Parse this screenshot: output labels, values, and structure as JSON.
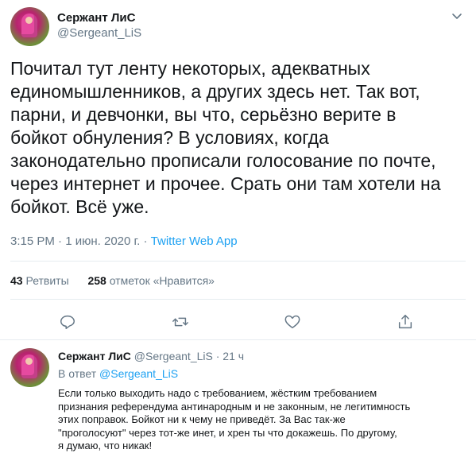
{
  "colors": {
    "accent": "#1da1f2",
    "secondary_text": "#657786",
    "primary_text": "#14171a",
    "divider": "#e6ecf0"
  },
  "tweet": {
    "author_name": "Сержант ЛиС",
    "author_handle": "@Sergeant_LiS",
    "text_lines": [
      "Почитал тут ленту некоторых, адекватных",
      "единомышленников, а других здесь нет. Так вот,",
      "парни, и девчонки, вы что, серьёзно верите в",
      "бойкот обнуления? В условиях, когда",
      "законодательно прописали голосование по почте,",
      "через интернет и прочее. Срать они там хотели на",
      "бойкот. Всё уже."
    ],
    "time": "3:15 PM",
    "sep": "·",
    "date": "1 июн. 2020 г.",
    "sep2": "·",
    "app": "Twitter Web App",
    "retweets_count": "43",
    "retweets_label": "Ретвиты",
    "likes_count": "258",
    "likes_label": "отметок «Нравится»",
    "icons": [
      "chevron-down-icon",
      "reply-icon",
      "retweet-icon",
      "like-icon",
      "share-icon"
    ]
  },
  "reply": {
    "author_name": "Сержант ЛиС",
    "author_handle": "@Sergeant_LiS",
    "sep": "·",
    "age": "21 ч",
    "in_reply_prefix": "В ответ",
    "in_reply_handle": "@Sergeant_LiS",
    "text_lines": [
      "Если только выходить надо с требованием, жёстким требованием",
      "признания референдума антинародным и не законным, не легитимность",
      "этих поправок. Бойкот ни к чему не приведёт. За Вас так-же",
      "\"проголосуют\" через тот-же инет, и хрен ты что докажешь. По другому,",
      "я думаю, что никак!"
    ]
  }
}
